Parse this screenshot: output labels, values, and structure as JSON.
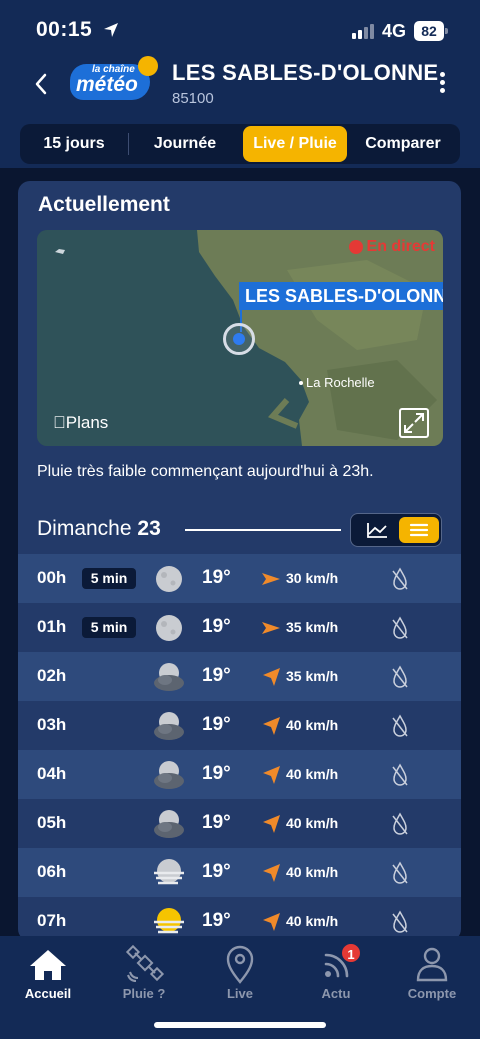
{
  "status_bar": {
    "time": "00:15",
    "network": "4G",
    "battery": "82"
  },
  "header": {
    "logo_line1": "la chaîne",
    "logo_line2": "météo",
    "city": "LES SABLES-D'OLONNE",
    "postal_code": "85100"
  },
  "tabs": [
    {
      "label": "15 jours",
      "active": false
    },
    {
      "label": "Journée",
      "active": false
    },
    {
      "label": "Live / Pluie",
      "active": true
    },
    {
      "label": "Comparer",
      "active": false
    }
  ],
  "current": {
    "title": "Actuellement",
    "map": {
      "live_label": "En direct",
      "location_label": "LES SABLES-D'OLONNE",
      "nearby_city": "La Rochelle",
      "attribution": "Plans"
    },
    "rain_message": "Pluie très faible commençant aujourd'hui à 23h."
  },
  "day": {
    "name": "Dimanche",
    "number": "23"
  },
  "hours": [
    {
      "hour": "00h",
      "badge": "5 min",
      "icon": "moon-clear-icon",
      "temp": "19°",
      "wind_dir": "right",
      "wind": "30 km/h",
      "alt": true
    },
    {
      "hour": "01h",
      "badge": "5 min",
      "icon": "moon-clear-icon",
      "temp": "19°",
      "wind_dir": "right",
      "wind": "35 km/h",
      "alt": false
    },
    {
      "hour": "02h",
      "badge": "",
      "icon": "moon-cloudy-icon",
      "temp": "19°",
      "wind_dir": "up-right",
      "wind": "35 km/h",
      "alt": true
    },
    {
      "hour": "03h",
      "badge": "",
      "icon": "moon-cloudy-icon",
      "temp": "19°",
      "wind_dir": "up-right",
      "wind": "40 km/h",
      "alt": false
    },
    {
      "hour": "04h",
      "badge": "",
      "icon": "moon-cloudy-icon",
      "temp": "19°",
      "wind_dir": "up-right",
      "wind": "40 km/h",
      "alt": true
    },
    {
      "hour": "05h",
      "badge": "",
      "icon": "moon-cloudy-icon",
      "temp": "19°",
      "wind_dir": "up-right",
      "wind": "40 km/h",
      "alt": false
    },
    {
      "hour": "06h",
      "badge": "",
      "icon": "moon-mist-icon",
      "temp": "19°",
      "wind_dir": "up-right",
      "wind": "40 km/h",
      "alt": true
    },
    {
      "hour": "07h",
      "badge": "",
      "icon": "sun-mist-icon",
      "temp": "19°",
      "wind_dir": "up-right",
      "wind": "40 km/h",
      "alt": false
    }
  ],
  "bottom_nav": [
    {
      "label": "Accueil",
      "icon": "home-icon",
      "active": true
    },
    {
      "label": "Pluie ?",
      "icon": "satellite-icon",
      "active": false
    },
    {
      "label": "Live",
      "icon": "location-pin-icon",
      "active": false
    },
    {
      "label": "Actu",
      "icon": "rss-icon",
      "active": false,
      "badge": "1"
    },
    {
      "label": "Compte",
      "icon": "user-icon",
      "active": false
    }
  ],
  "colors": {
    "accent": "#f5b400",
    "background": "#0a1630",
    "header": "#132a56",
    "card": "#233a69",
    "wind_arrow": "#f08a2a",
    "live_red": "#e53935"
  }
}
